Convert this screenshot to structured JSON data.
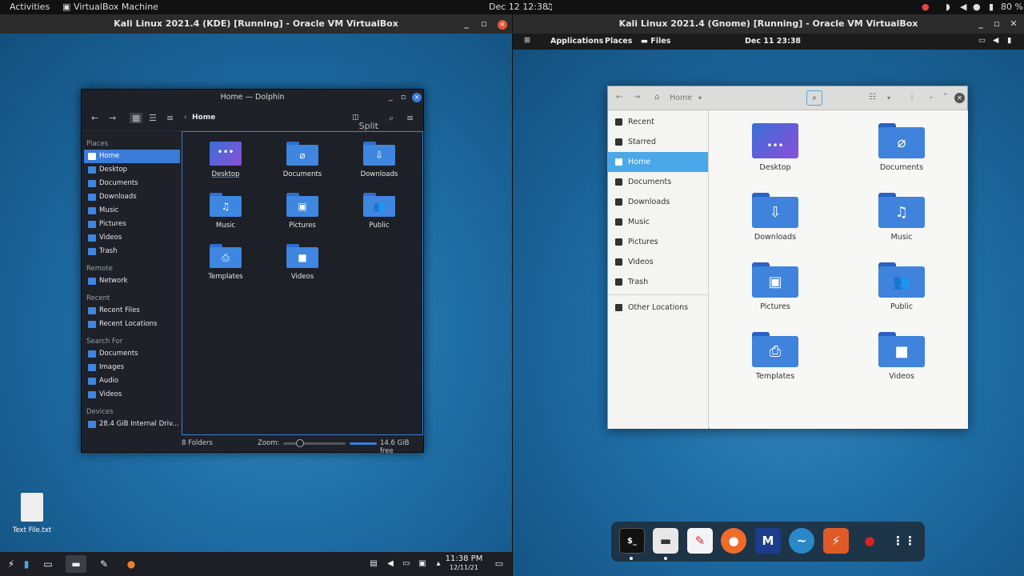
{
  "host_bar": {
    "activities": "Activities",
    "app": "VirtualBox Machine",
    "clock": "Dec 12  12:38",
    "battery": "80 %"
  },
  "vm_left": {
    "title": "Kali Linux 2021.4 (KDE) [Running] - Oracle VM VirtualBox"
  },
  "vm_right": {
    "title": "Kali Linux 2021.4 (Gnome) [Running] - Oracle VM VirtualBox"
  },
  "gnome_bar": {
    "applications": "Applications",
    "places": "Places",
    "files": "Files",
    "clock": "Dec 11  23:38"
  },
  "dolphin": {
    "title": "Home — Dolphin",
    "breadcrumb": "Home",
    "split": "Split",
    "sections": [
      {
        "header": "Places",
        "items": [
          "Home",
          "Desktop",
          "Documents",
          "Downloads",
          "Music",
          "Pictures",
          "Videos",
          "Trash"
        ]
      },
      {
        "header": "Remote",
        "items": [
          "Network"
        ]
      },
      {
        "header": "Recent",
        "items": [
          "Recent Files",
          "Recent Locations"
        ]
      },
      {
        "header": "Search For",
        "items": [
          "Documents",
          "Images",
          "Audio",
          "Videos"
        ]
      },
      {
        "header": "Devices",
        "items": [
          "28.4 GiB Internal Driv..."
        ]
      }
    ],
    "files": [
      "Desktop",
      "Documents",
      "Downloads",
      "Music",
      "Pictures",
      "Public",
      "Templates",
      "Videos"
    ],
    "status": {
      "count": "8 Folders",
      "zoom": "Zoom:",
      "free": "14.6 GiB free"
    }
  },
  "desktop_file": "Text File.txt",
  "kde_clock": {
    "time": "11:38 PM",
    "date": "12/11/21"
  },
  "nautilus": {
    "path": "Home",
    "sidebar": [
      "Recent",
      "Starred",
      "Home",
      "Documents",
      "Downloads",
      "Music",
      "Pictures",
      "Videos",
      "Trash",
      "Other Locations"
    ],
    "files": [
      "Desktop",
      "Documents",
      "Downloads",
      "Music",
      "Pictures",
      "Public",
      "Templates",
      "Videos"
    ]
  },
  "colors": {
    "accent_kde": "#3d7bd9",
    "accent_gnome": "#4aa8e8",
    "folder": "#3f83dc"
  }
}
